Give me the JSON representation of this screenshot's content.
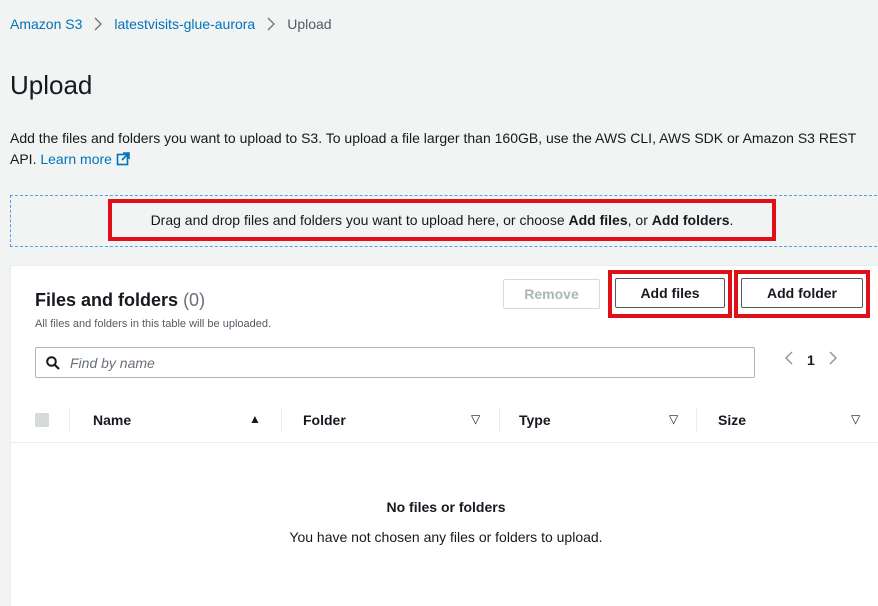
{
  "breadcrumb": {
    "items": [
      {
        "label": "Amazon S3"
      },
      {
        "label": "latestvisits-glue-aurora"
      }
    ],
    "current": "Upload"
  },
  "page": {
    "title": "Upload",
    "description": "Add the files and folders you want to upload to S3. To upload a file larger than 160GB, use the AWS CLI, AWS SDK or Amazon S3 REST API.",
    "learn_more": "Learn more"
  },
  "dropzone": {
    "text_before": "Drag and drop files and folders you want to upload here, or choose ",
    "add_files": "Add files",
    "text_middle": ", or ",
    "add_folders": "Add folders",
    "text_after": "."
  },
  "files_panel": {
    "title": "Files and folders",
    "count": "(0)",
    "subtitle": "All files and folders in this table will be uploaded.",
    "buttons": {
      "remove": "Remove",
      "add_files": "Add files",
      "add_folder": "Add folder"
    },
    "search": {
      "placeholder": "Find by name",
      "value": ""
    },
    "pagination": {
      "current_page": "1",
      "prev_icon": "chevron-left-icon",
      "next_icon": "chevron-right-icon"
    },
    "columns": [
      {
        "label": "Name",
        "sort": "▲"
      },
      {
        "label": "Folder",
        "sort": "▽"
      },
      {
        "label": "Type",
        "sort": "▽"
      },
      {
        "label": "Size",
        "sort": "▽"
      }
    ],
    "empty": {
      "title": "No files or folders",
      "message": "You have not chosen any files or folders to upload."
    }
  },
  "colors": {
    "link": "#0073bb",
    "highlight": "#e01019",
    "dropzone_border": "#539fe5",
    "background": "#f2f3f3"
  }
}
